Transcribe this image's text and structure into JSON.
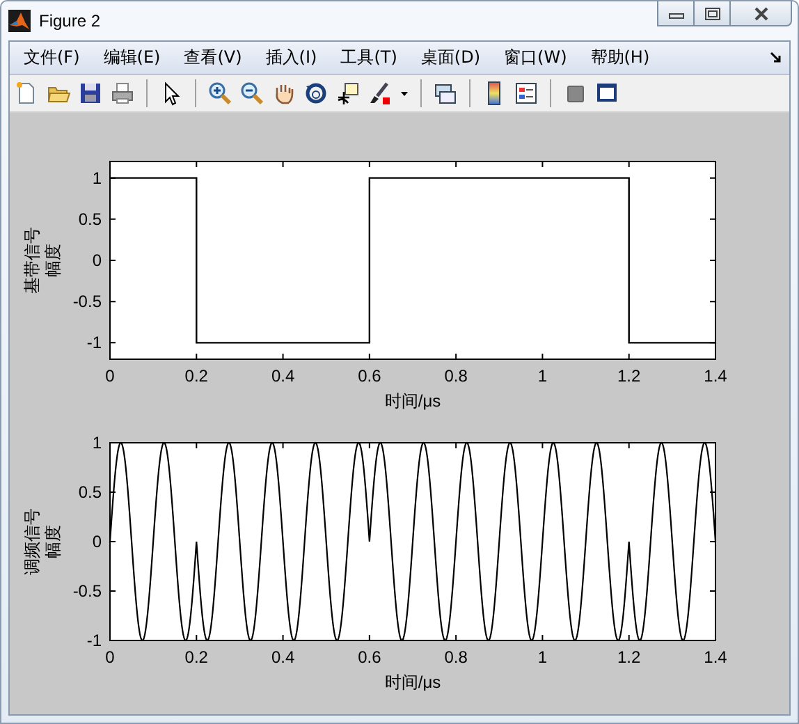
{
  "window": {
    "title": "Figure 2"
  },
  "menu": [
    "文件(F)",
    "编辑(E)",
    "查看(V)",
    "插入(I)",
    "工具(T)",
    "桌面(D)",
    "窗口(W)",
    "帮助(H)"
  ],
  "plots": [
    {
      "kind": "chart",
      "ylabel_lines": [
        "基带信号",
        "幅度"
      ],
      "chart_data": {
        "type": "line",
        "xlabel": "时间/μs",
        "x": [
          0,
          0.2,
          0.2,
          0.6,
          0.6,
          1.2,
          1.2,
          1.4
        ],
        "series": [
          {
            "color": "#000000",
            "values": [
              1,
              1,
              -1,
              -1,
              1,
              1,
              -1,
              -1
            ]
          }
        ],
        "xlim": [
          0,
          1.4
        ],
        "ylim": [
          -1.2,
          1.2
        ],
        "xticks": [
          0,
          0.2,
          0.4,
          0.6,
          0.8,
          1,
          1.2,
          1.4
        ],
        "yticks": [
          -1,
          -0.5,
          0,
          0.5,
          1
        ]
      }
    },
    {
      "kind": "waveform",
      "ylabel_lines": [
        "调频信号",
        "幅度"
      ],
      "xlabel": "时间/μs",
      "xticks": [
        "0",
        "0.2",
        "0.4",
        "0.6",
        "0.8",
        "1",
        "1.2",
        "1.4"
      ],
      "yticks": [
        "1",
        "0.5",
        "0",
        "-0.5",
        "-1"
      ]
    }
  ]
}
